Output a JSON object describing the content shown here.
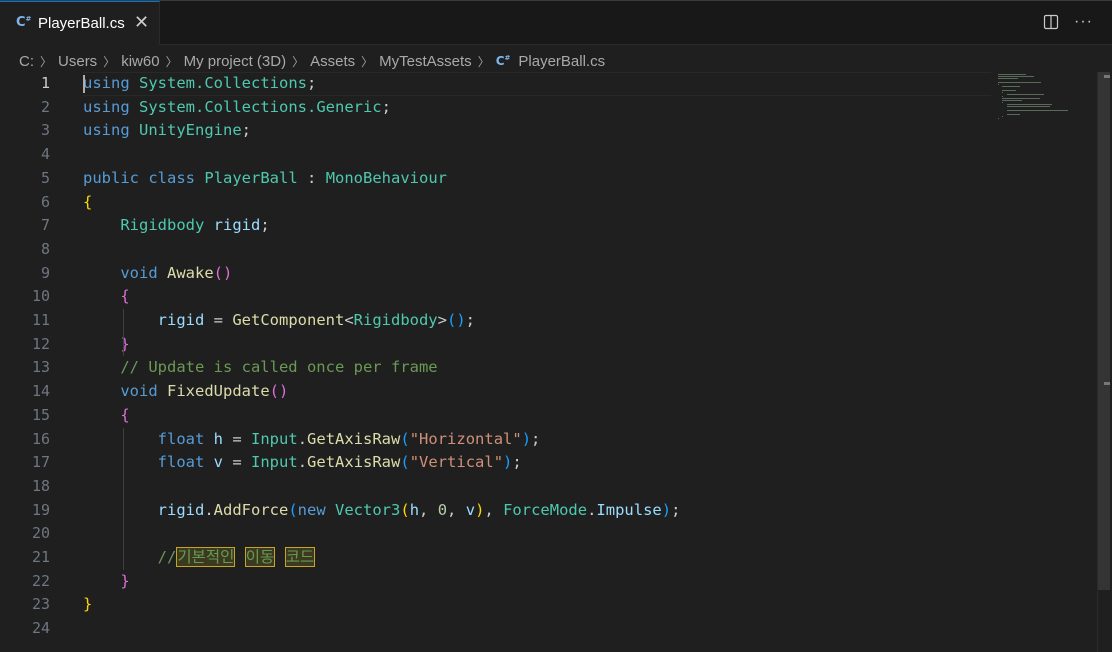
{
  "tab": {
    "icon": "csharp-file-icon",
    "label": "PlayerBall.cs",
    "close_glyph": "✕"
  },
  "toolbar": {
    "split_icon": "split-editor-icon",
    "more_glyph": "···"
  },
  "breadcrumb": {
    "segments": [
      "C:",
      "Users",
      "kiw60",
      "My project (3D)",
      "Assets",
      "MyTestAssets"
    ],
    "file": "PlayerBall.cs"
  },
  "editor": {
    "active_line": 1,
    "line_numbers": [
      "1",
      "2",
      "3",
      "4",
      "5",
      "6",
      "7",
      "8",
      "9",
      "10",
      "11",
      "12",
      "13",
      "14",
      "15",
      "16",
      "17",
      "18",
      "19",
      "20",
      "21",
      "22",
      "23",
      "24"
    ],
    "lines": [
      [
        [
          "kw",
          "using"
        ],
        [
          "plain",
          " "
        ],
        [
          "ns",
          "System.Collections"
        ],
        [
          "plain",
          ";"
        ]
      ],
      [
        [
          "kw",
          "using"
        ],
        [
          "plain",
          " "
        ],
        [
          "ns",
          "System.Collections.Generic"
        ],
        [
          "plain",
          ";"
        ]
      ],
      [
        [
          "kw",
          "using"
        ],
        [
          "plain",
          " "
        ],
        [
          "ns",
          "UnityEngine"
        ],
        [
          "plain",
          ";"
        ]
      ],
      [],
      [
        [
          "kw",
          "public"
        ],
        [
          "plain",
          " "
        ],
        [
          "kw",
          "class"
        ],
        [
          "plain",
          " "
        ],
        [
          "ty",
          "PlayerBall"
        ],
        [
          "plain",
          " : "
        ],
        [
          "ty",
          "MonoBehaviour"
        ]
      ],
      [
        [
          "br1",
          "{"
        ]
      ],
      [
        [
          "plain",
          "    "
        ],
        [
          "ty",
          "Rigidbody"
        ],
        [
          "plain",
          " "
        ],
        [
          "var",
          "rigid"
        ],
        [
          "plain",
          ";"
        ]
      ],
      [],
      [
        [
          "plain",
          "    "
        ],
        [
          "kw",
          "void"
        ],
        [
          "plain",
          " "
        ],
        [
          "fn",
          "Awake"
        ],
        [
          "br2",
          "()"
        ]
      ],
      [
        [
          "plain",
          "    "
        ],
        [
          "br2",
          "{"
        ]
      ],
      [
        [
          "plain",
          "        "
        ],
        [
          "var",
          "rigid"
        ],
        [
          "plain",
          " = "
        ],
        [
          "fn",
          "GetComponent"
        ],
        [
          "plain",
          "<"
        ],
        [
          "ty",
          "Rigidbody"
        ],
        [
          "plain",
          ">"
        ],
        [
          "br3",
          "()"
        ],
        [
          "plain",
          ";"
        ]
      ],
      [
        [
          "plain",
          "    "
        ],
        [
          "br2",
          "}"
        ]
      ],
      [
        [
          "plain",
          "    "
        ],
        [
          "cm",
          "// Update is called once per frame"
        ]
      ],
      [
        [
          "plain",
          "    "
        ],
        [
          "kw",
          "void"
        ],
        [
          "plain",
          " "
        ],
        [
          "fn",
          "FixedUpdate"
        ],
        [
          "br2",
          "()"
        ]
      ],
      [
        [
          "plain",
          "    "
        ],
        [
          "br2",
          "{"
        ]
      ],
      [
        [
          "plain",
          "        "
        ],
        [
          "kw",
          "float"
        ],
        [
          "plain",
          " "
        ],
        [
          "var",
          "h"
        ],
        [
          "plain",
          " = "
        ],
        [
          "ty",
          "Input"
        ],
        [
          "plain",
          "."
        ],
        [
          "fn",
          "GetAxisRaw"
        ],
        [
          "br3",
          "("
        ],
        [
          "str",
          "\"Horizontal\""
        ],
        [
          "br3",
          ")"
        ],
        [
          "plain",
          ";"
        ]
      ],
      [
        [
          "plain",
          "        "
        ],
        [
          "kw",
          "float"
        ],
        [
          "plain",
          " "
        ],
        [
          "var",
          "v"
        ],
        [
          "plain",
          " = "
        ],
        [
          "ty",
          "Input"
        ],
        [
          "plain",
          "."
        ],
        [
          "fn",
          "GetAxisRaw"
        ],
        [
          "br3",
          "("
        ],
        [
          "str",
          "\"Vertical\""
        ],
        [
          "br3",
          ")"
        ],
        [
          "plain",
          ";"
        ]
      ],
      [],
      [
        [
          "plain",
          "        "
        ],
        [
          "var",
          "rigid"
        ],
        [
          "plain",
          "."
        ],
        [
          "fn",
          "AddForce"
        ],
        [
          "br3",
          "("
        ],
        [
          "kw",
          "new"
        ],
        [
          "plain",
          " "
        ],
        [
          "ty",
          "Vector3"
        ],
        [
          "br1",
          "("
        ],
        [
          "var",
          "h"
        ],
        [
          "plain",
          ", "
        ],
        [
          "num",
          "0"
        ],
        [
          "plain",
          ", "
        ],
        [
          "var",
          "v"
        ],
        [
          "br1",
          ")"
        ],
        [
          "plain",
          ", "
        ],
        [
          "ty",
          "ForceMode"
        ],
        [
          "plain",
          "."
        ],
        [
          "var",
          "Impulse"
        ],
        [
          "br3",
          ")"
        ],
        [
          "plain",
          ";"
        ]
      ],
      [],
      [
        [
          "plain",
          "        "
        ],
        [
          "cm",
          "//"
        ],
        [
          "cm-hl",
          "기본적인"
        ],
        [
          "cm",
          " "
        ],
        [
          "cm-hl",
          "이동"
        ],
        [
          "cm",
          " "
        ],
        [
          "cm-hl",
          "코드"
        ]
      ],
      [
        [
          "plain",
          "    "
        ],
        [
          "br2",
          "}"
        ]
      ],
      [
        [
          "br1",
          "}"
        ]
      ],
      []
    ]
  },
  "colors": {
    "accent": "#0078d4",
    "background": "#1f1f1f",
    "keyword": "#569cd6",
    "type": "#4ec9b0",
    "function": "#dcdcaa",
    "variable": "#9cdcfe",
    "string": "#ce9178",
    "comment": "#6a9955"
  }
}
